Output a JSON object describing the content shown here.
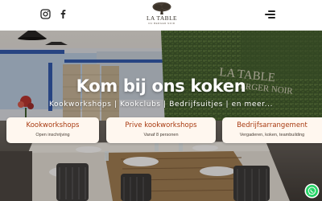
{
  "header": {
    "social": [
      {
        "icon": "instagram-icon"
      },
      {
        "icon": "facebook-icon"
      }
    ],
    "logo": {
      "title": "LA TABLE",
      "subtitle": "DU BERGER NOIR"
    },
    "menu_icon": "hamburger-menu-icon"
  },
  "hero": {
    "title": "Kom bij ons koken",
    "subtitle": "Kookworkshops | Kookclubs | Bedrijfsuitjes | en meer...",
    "wall_sign": {
      "line1": "LA TABLE",
      "line2": "ERGER NOIR"
    }
  },
  "cards": [
    {
      "title": "Kookworkshops",
      "description": "Open inschrijving"
    },
    {
      "title": "Prive kookworkshops",
      "description": "Vanaf 8 personen"
    },
    {
      "title": "Bedrijfsarrangement",
      "description": "Vergaderen, koken, teambuilding"
    }
  ],
  "floating": {
    "whatsapp_icon": "whatsapp-icon"
  },
  "colors": {
    "card_title": "#a83a10",
    "card_bg": "#fff7ef",
    "header_bg": "#ffffff",
    "whatsapp": "#25d366"
  }
}
